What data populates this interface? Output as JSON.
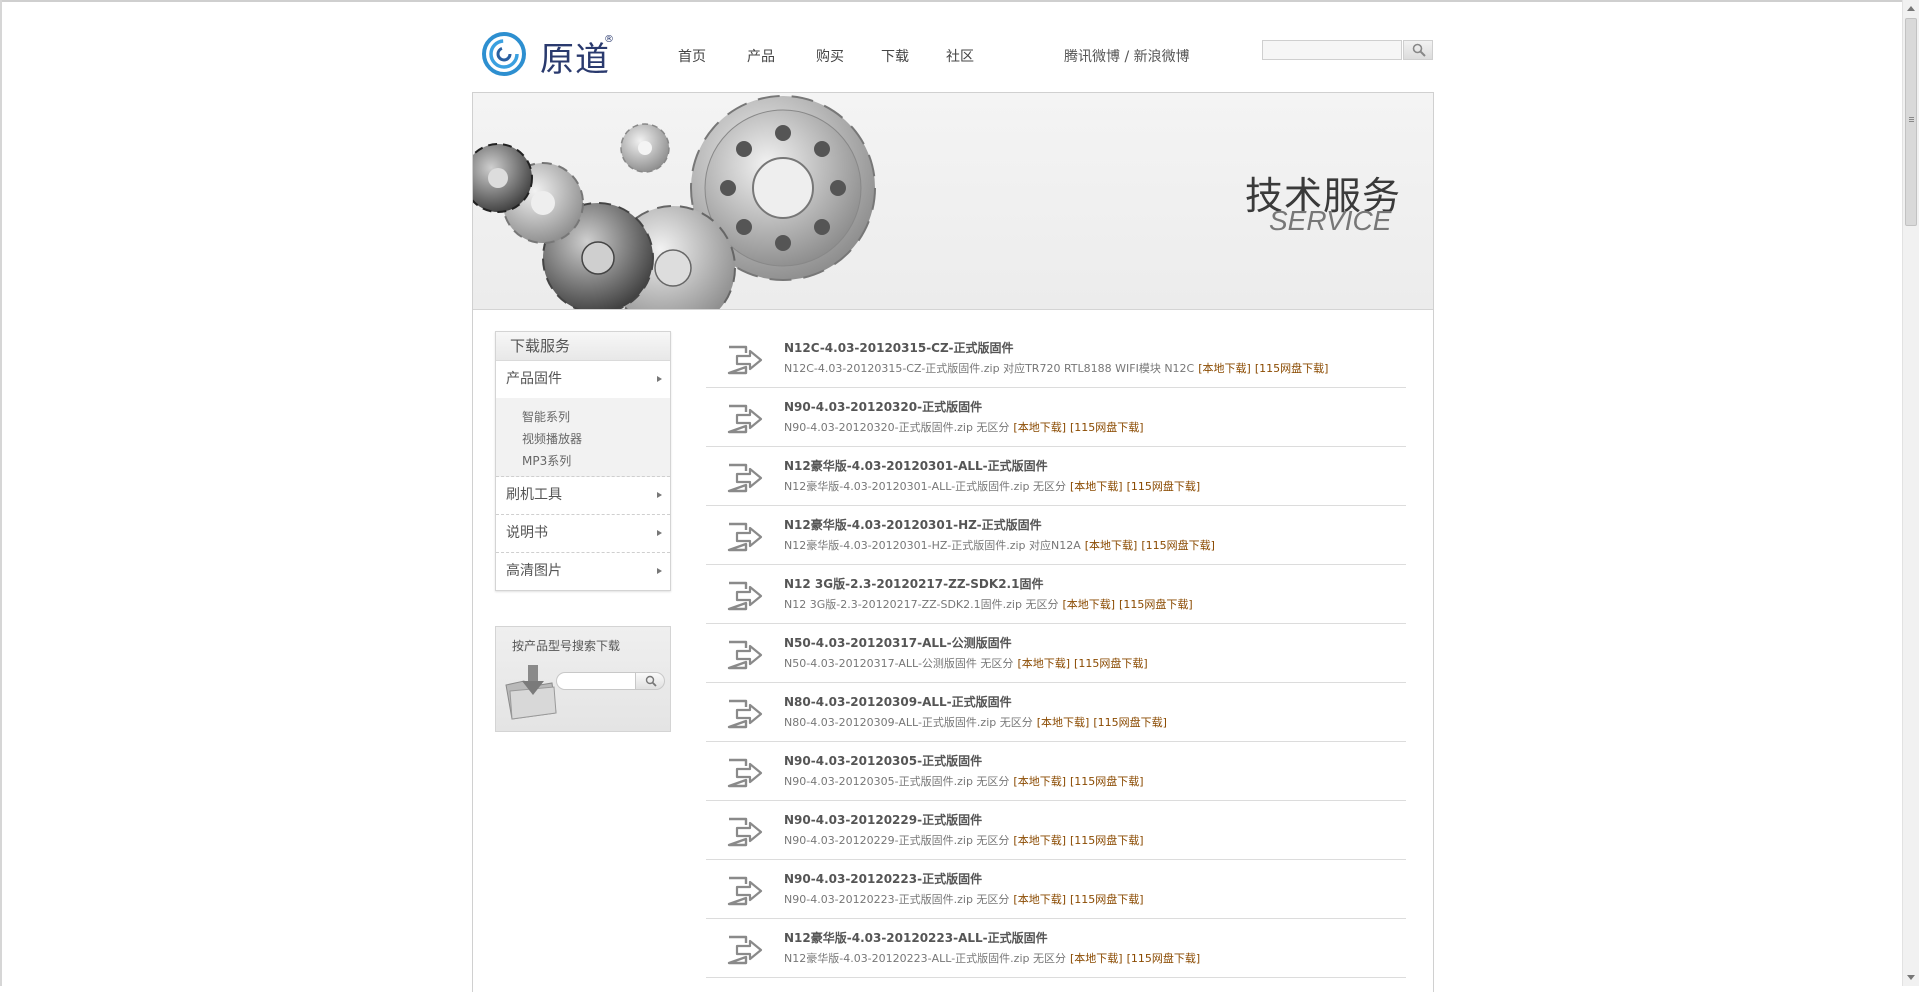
{
  "header": {
    "logo_text": "原道",
    "logo_reg": "®",
    "nav": [
      {
        "label": "首页"
      },
      {
        "label": "产品"
      },
      {
        "label": "购买"
      },
      {
        "label": "下载"
      },
      {
        "label": "社区"
      }
    ],
    "social": {
      "tencent": "腾讯微博",
      "separator": " / ",
      "sina": "新浪微博"
    },
    "search_placeholder": ""
  },
  "banner": {
    "title": "技术服务",
    "subtitle": "SERVICE"
  },
  "sidebar": {
    "heading": "下载服务",
    "items": [
      {
        "label": "产品固件",
        "sub": [
          "智能系列",
          "视频播放器",
          "MP3系列"
        ]
      },
      {
        "label": "刷机工具"
      },
      {
        "label": "说明书"
      },
      {
        "label": "高清图片"
      }
    ],
    "search_label": "按产品型号搜索下载",
    "search_placeholder": ""
  },
  "downloads": [
    {
      "title": "N12C-4.03-20120315-CZ-正式版固件",
      "desc": "N12C-4.03-20120315-CZ-正式版固件.zip 对应TR720 RTL8188 WIFI模块 N12C",
      "local": "[本地下载]",
      "cloud": "[115网盘下载]"
    },
    {
      "title": "N90-4.03-20120320-正式版固件",
      "desc": "N90-4.03-20120320-正式版固件.zip 无区分",
      "local": "[本地下载]",
      "cloud": "[115网盘下载]"
    },
    {
      "title": "N12豪华版-4.03-20120301-ALL-正式版固件",
      "desc": "N12豪华版-4.03-20120301-ALL-正式版固件.zip 无区分",
      "local": "[本地下载]",
      "cloud": "[115网盘下载]"
    },
    {
      "title": "N12豪华版-4.03-20120301-HZ-正式版固件",
      "desc": "N12豪华版-4.03-20120301-HZ-正式版固件.zip 对应N12A",
      "local": "[本地下载]",
      "cloud": "[115网盘下载]"
    },
    {
      "title": "N12 3G版-2.3-20120217-ZZ-SDK2.1固件",
      "desc": "N12 3G版-2.3-20120217-ZZ-SDK2.1固件.zip 无区分",
      "local": "[本地下载]",
      "cloud": "[115网盘下载]"
    },
    {
      "title": "N50-4.03-20120317-ALL-公测版固件",
      "desc": "N50-4.03-20120317-ALL-公测版固件 无区分",
      "local": "[本地下载]",
      "cloud": "[115网盘下载]"
    },
    {
      "title": "N80-4.03-20120309-ALL-正式版固件",
      "desc": "N80-4.03-20120309-ALL-正式版固件.zip 无区分",
      "local": "[本地下载]",
      "cloud": "[115网盘下载]"
    },
    {
      "title": "N90-4.03-20120305-正式版固件",
      "desc": "N90-4.03-20120305-正式版固件.zip 无区分",
      "local": "[本地下载]",
      "cloud": "[115网盘下载]"
    },
    {
      "title": "N90-4.03-20120229-正式版固件",
      "desc": "N90-4.03-20120229-正式版固件.zip 无区分",
      "local": "[本地下载]",
      "cloud": "[115网盘下载]"
    },
    {
      "title": "N90-4.03-20120223-正式版固件",
      "desc": "N90-4.03-20120223-正式版固件.zip 无区分",
      "local": "[本地下载]",
      "cloud": "[115网盘下载]"
    },
    {
      "title": "N12豪华版-4.03-20120223-ALL-正式版固件",
      "desc": "N12豪华版-4.03-20120223-ALL-正式版固件.zip 无区分",
      "local": "[本地下载]",
      "cloud": "[115网盘下载]"
    }
  ],
  "colors": {
    "link": "#8a4a00",
    "logo": "#2a3a6e"
  },
  "icons": [
    "logo-swirl-icon",
    "search-icon",
    "download-arrow-icon",
    "folder-download-icon",
    "gears-icon"
  ]
}
